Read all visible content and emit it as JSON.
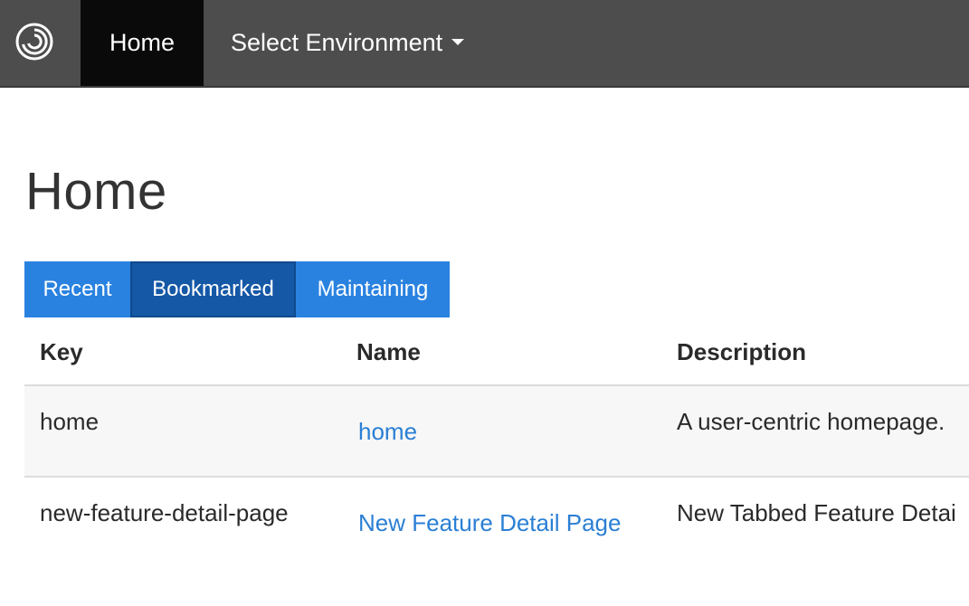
{
  "navbar": {
    "logo_icon": "app-logo-icon",
    "home_label": "Home",
    "environment_label": "Select Environment",
    "background": "#4d4d4d",
    "active_background": "#0a0a0a"
  },
  "page": {
    "title": "Home"
  },
  "tabs": [
    {
      "label": "Recent",
      "active": false
    },
    {
      "label": "Bookmarked",
      "active": true
    },
    {
      "label": "Maintaining",
      "active": false
    }
  ],
  "table": {
    "headers": {
      "key": "Key",
      "name": "Name",
      "description": "Description"
    },
    "rows": [
      {
        "key": "home",
        "name": "home",
        "description": "A user-centric homepage."
      },
      {
        "key": "new-feature-detail-page",
        "name": "New Feature Detail Page",
        "description": "New Tabbed Feature Detai"
      }
    ]
  },
  "colors": {
    "tab": "#2a82e0",
    "tab_active": "#1558a6",
    "link": "#2a7fd4"
  }
}
